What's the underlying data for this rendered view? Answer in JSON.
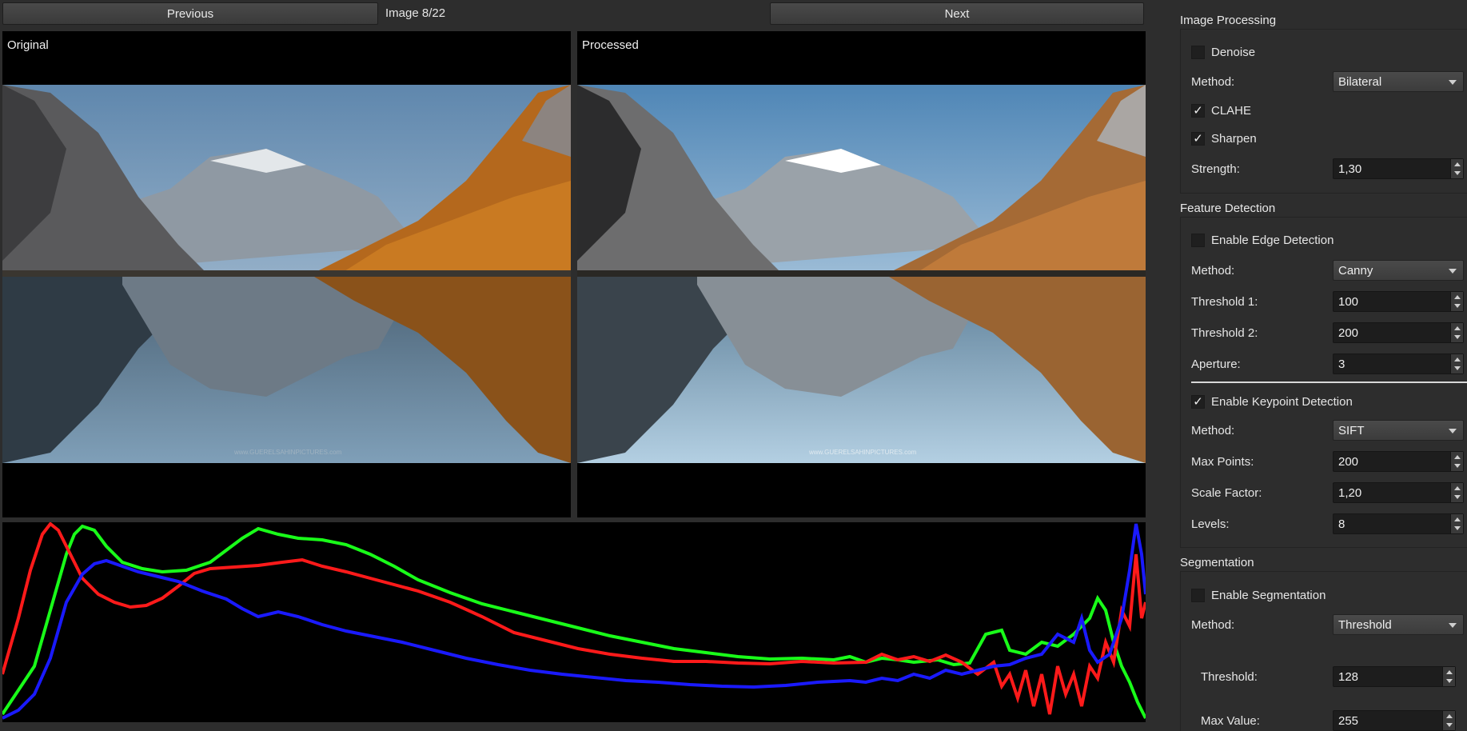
{
  "nav": {
    "previous_label": "Previous",
    "next_label": "Next",
    "counter": "Image 8/22"
  },
  "panels": {
    "original_label": "Original",
    "processed_label": "Processed",
    "watermark": "www.GUERELSAHINPICTURES.com"
  },
  "histogram": {
    "colors": {
      "red": "#ff1a1a",
      "green": "#19ff19",
      "blue": "#1a1aff"
    }
  },
  "image_processing": {
    "title": "Image Processing",
    "denoise_label": "Denoise",
    "denoise_checked": false,
    "method_label": "Method:",
    "method_value": "Bilateral",
    "clahe_label": "CLAHE",
    "clahe_checked": true,
    "sharpen_label": "Sharpen",
    "sharpen_checked": true,
    "strength_label": "Strength:",
    "strength_value": "1,30"
  },
  "feature_detection": {
    "title": "Feature Detection",
    "edge_label": "Enable Edge Detection",
    "edge_checked": false,
    "edge_method_label": "Method:",
    "edge_method_value": "Canny",
    "threshold1_label": "Threshold 1:",
    "threshold1_value": "100",
    "threshold2_label": "Threshold 2:",
    "threshold2_value": "200",
    "aperture_label": "Aperture:",
    "aperture_value": "3",
    "keypoint_label": "Enable Keypoint Detection",
    "keypoint_checked": true,
    "kp_method_label": "Method:",
    "kp_method_value": "SIFT",
    "max_points_label": "Max Points:",
    "max_points_value": "200",
    "scale_factor_label": "Scale Factor:",
    "scale_factor_value": "1,20",
    "levels_label": "Levels:",
    "levels_value": "8"
  },
  "segmentation": {
    "title": "Segmentation",
    "enable_label": "Enable Segmentation",
    "enable_checked": false,
    "method_label": "Method:",
    "method_value": "Threshold",
    "threshold_label": "Threshold:",
    "threshold_value": "128",
    "max_value_label": "Max Value:",
    "max_value_value": "255"
  },
  "check_glyph": "✓"
}
